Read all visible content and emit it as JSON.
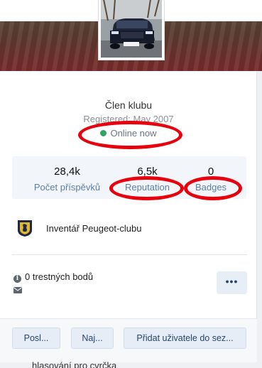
{
  "profile": {
    "member_title": "Člen klubu",
    "registered": "Registered: May 2007",
    "online_status": "Online now"
  },
  "stats": [
    {
      "value": "28,4k",
      "label": "Počet příspěvků"
    },
    {
      "value": "6,5k",
      "label": "Reputation"
    },
    {
      "value": "0",
      "label": "Badges"
    }
  ],
  "car_list": {
    "label": "Inventář Peugeot-clubu"
  },
  "warnings": {
    "label": "0 trestných bodů"
  },
  "buttons": {
    "more": "•••",
    "message": "Posl...",
    "find": "Naj...",
    "add_to_list": "Přidat uživatele do sez..."
  },
  "background_text": "hlasování pro cvrčka",
  "colors": {
    "accent": "#24466e",
    "online": "#2ea36b",
    "annotation": "#e8000c"
  },
  "icons": [
    "info-icon",
    "envelope-icon",
    "peugeot-lion-logo",
    "more-icon"
  ]
}
